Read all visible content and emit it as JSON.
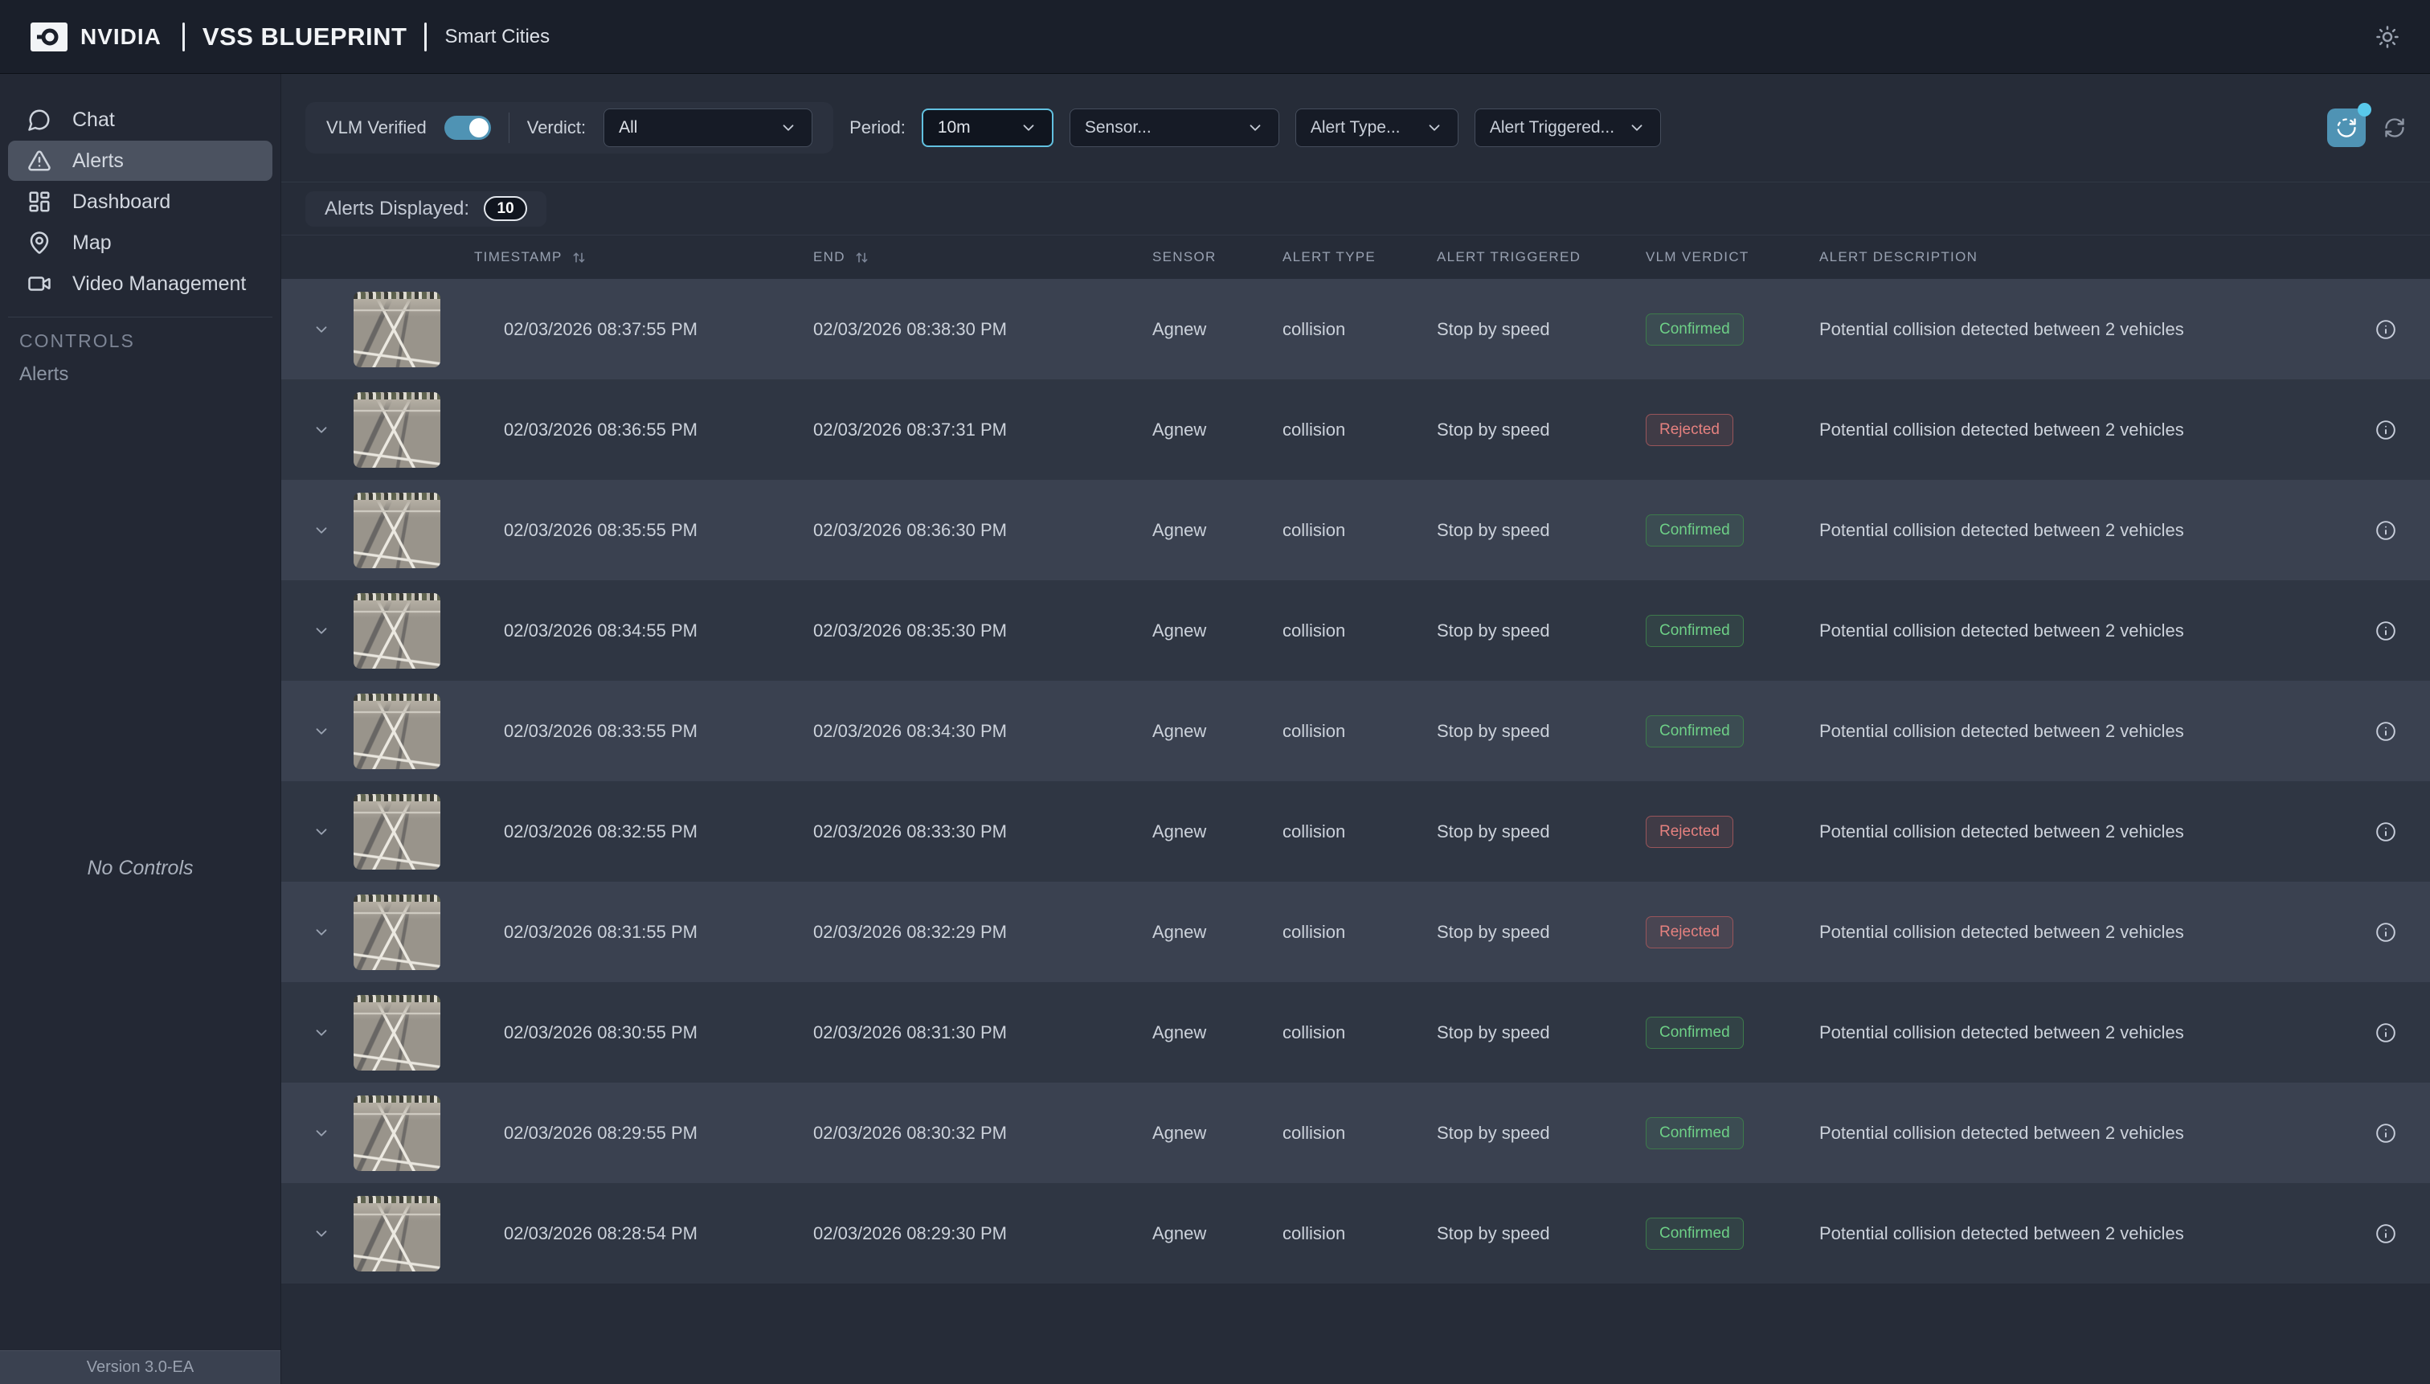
{
  "topbar": {
    "brand": "NVIDIA",
    "title": "VSS BLUEPRINT",
    "subtitle": "Smart Cities"
  },
  "sidebar": {
    "items": [
      {
        "label": "Chat"
      },
      {
        "label": "Alerts"
      },
      {
        "label": "Dashboard"
      },
      {
        "label": "Map"
      },
      {
        "label": "Video Management"
      }
    ],
    "active_item": "Alerts",
    "controls_header": "CONTROLS",
    "controls_item": "Alerts",
    "empty_controls": "No Controls",
    "version": "Version 3.0-EA"
  },
  "filters": {
    "vlm_verified": {
      "label": "VLM Verified",
      "on": true
    },
    "verdict": {
      "label": "Verdict:",
      "value": "All"
    },
    "period": {
      "label": "Period:",
      "value": "10m"
    },
    "sensor": {
      "placeholder": "Sensor..."
    },
    "alert_type": {
      "placeholder": "Alert Type..."
    },
    "alert_triggered": {
      "placeholder": "Alert Triggered..."
    }
  },
  "alerts_displayed": {
    "label": "Alerts Displayed:",
    "count": "10"
  },
  "table": {
    "columns": [
      "TIMESTAMP",
      "END",
      "SENSOR",
      "ALERT TYPE",
      "ALERT TRIGGERED",
      "VLM VERDICT",
      "ALERT DESCRIPTION"
    ],
    "rows": [
      {
        "timestamp": "02/03/2026 08:37:55 PM",
        "end": "02/03/2026 08:38:30 PM",
        "sensor": "Agnew",
        "alert_type": "collision",
        "alert_triggered": "Stop by speed",
        "verdict": "Confirmed",
        "description": "Potential collision detected between 2 vehicles"
      },
      {
        "timestamp": "02/03/2026 08:36:55 PM",
        "end": "02/03/2026 08:37:31 PM",
        "sensor": "Agnew",
        "alert_type": "collision",
        "alert_triggered": "Stop by speed",
        "verdict": "Rejected",
        "description": "Potential collision detected between 2 vehicles"
      },
      {
        "timestamp": "02/03/2026 08:35:55 PM",
        "end": "02/03/2026 08:36:30 PM",
        "sensor": "Agnew",
        "alert_type": "collision",
        "alert_triggered": "Stop by speed",
        "verdict": "Confirmed",
        "description": "Potential collision detected between 2 vehicles"
      },
      {
        "timestamp": "02/03/2026 08:34:55 PM",
        "end": "02/03/2026 08:35:30 PM",
        "sensor": "Agnew",
        "alert_type": "collision",
        "alert_triggered": "Stop by speed",
        "verdict": "Confirmed",
        "description": "Potential collision detected between 2 vehicles"
      },
      {
        "timestamp": "02/03/2026 08:33:55 PM",
        "end": "02/03/2026 08:34:30 PM",
        "sensor": "Agnew",
        "alert_type": "collision",
        "alert_triggered": "Stop by speed",
        "verdict": "Confirmed",
        "description": "Potential collision detected between 2 vehicles"
      },
      {
        "timestamp": "02/03/2026 08:32:55 PM",
        "end": "02/03/2026 08:33:30 PM",
        "sensor": "Agnew",
        "alert_type": "collision",
        "alert_triggered": "Stop by speed",
        "verdict": "Rejected",
        "description": "Potential collision detected between 2 vehicles"
      },
      {
        "timestamp": "02/03/2026 08:31:55 PM",
        "end": "02/03/2026 08:32:29 PM",
        "sensor": "Agnew",
        "alert_type": "collision",
        "alert_triggered": "Stop by speed",
        "verdict": "Rejected",
        "description": "Potential collision detected between 2 vehicles"
      },
      {
        "timestamp": "02/03/2026 08:30:55 PM",
        "end": "02/03/2026 08:31:30 PM",
        "sensor": "Agnew",
        "alert_type": "collision",
        "alert_triggered": "Stop by speed",
        "verdict": "Confirmed",
        "description": "Potential collision detected between 2 vehicles"
      },
      {
        "timestamp": "02/03/2026 08:29:55 PM",
        "end": "02/03/2026 08:30:32 PM",
        "sensor": "Agnew",
        "alert_type": "collision",
        "alert_triggered": "Stop by speed",
        "verdict": "Confirmed",
        "description": "Potential collision detected between 2 vehicles"
      },
      {
        "timestamp": "02/03/2026 08:28:54 PM",
        "end": "02/03/2026 08:29:30 PM",
        "sensor": "Agnew",
        "alert_type": "collision",
        "alert_triggered": "Stop by speed",
        "verdict": "Confirmed",
        "description": "Potential collision detected between 2 vehicles"
      }
    ]
  },
  "colors": {
    "accent_teal": "#4f93b4",
    "accent_cyan": "#5fc4e6",
    "confirmed_green": "#6ed087",
    "rejected_red": "#e5817f"
  }
}
